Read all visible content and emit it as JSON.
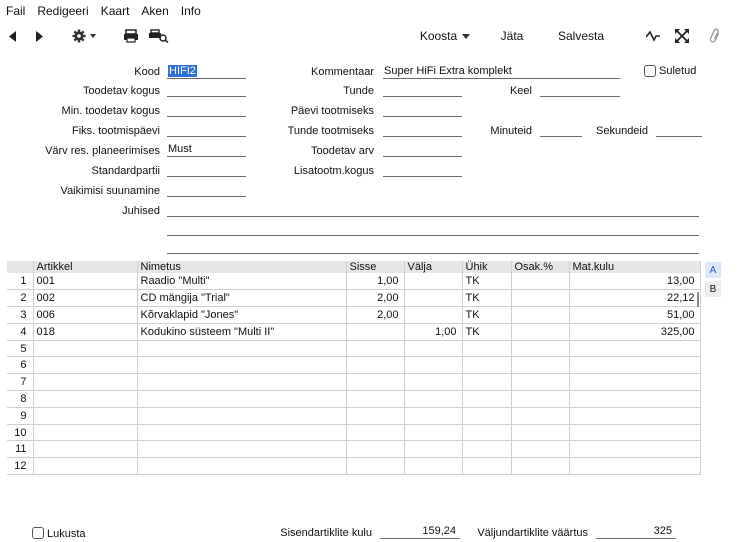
{
  "menu": [
    "Fail",
    "Redigeeri",
    "Kaart",
    "Aken",
    "Info"
  ],
  "toolbar": {
    "create": "Koosta",
    "skip": "Jäta",
    "save": "Salvesta"
  },
  "labels": {
    "code": "Kood",
    "qty_produced": "Toodetav kogus",
    "min_qty": "Min. toodetav kogus",
    "fixed_days": "Fiks. tootmispäevi",
    "colour_planning": "Värv res. planeerimises",
    "std_batch": "Standardpartii",
    "default_routing": "Vaikimisi suunamine",
    "instructions": "Juhised",
    "comment": "Kommentaar",
    "hours": "Tunde",
    "days_prod": "Päevi tootmiseks",
    "hours_prod": "Tunde tootmiseks",
    "value_produced": "Toodetav arv",
    "extra_qty": "Lisatootm.kogus",
    "language": "Keel",
    "minutes": "Minuteid",
    "seconds": "Sekundeid",
    "closed": "Suletud",
    "lock": "Lukusta",
    "input_cost": "Sisendartiklite kulu",
    "output_value": "Väljundartiklite väärtus"
  },
  "values": {
    "code": "HIFI2",
    "comment": "Super HiFi Extra komplekt",
    "colour_planning": "Must",
    "input_cost": "159,24",
    "output_value": "325"
  },
  "grid": {
    "columns": [
      "Artikkel",
      "Nimetus",
      "Sisse",
      "Välja",
      "Ühik",
      "Osak.%",
      "Mat.kulu"
    ],
    "rows": [
      [
        "1",
        "001",
        "Raadio \"Multi\"",
        "1,00",
        "",
        "TK",
        "",
        "13,00"
      ],
      [
        "2",
        "002",
        "CD mängija \"Trial\"",
        "2,00",
        "",
        "TK",
        "",
        "22,12"
      ],
      [
        "3",
        "006",
        "Kõrvaklapid \"Jones\"",
        "2,00",
        "",
        "TK",
        "",
        "51,00"
      ],
      [
        "4",
        "018",
        "Kodukino süsteem \"Multi II\"",
        "",
        "1,00",
        "TK",
        "",
        "325,00"
      ],
      [
        "5",
        "",
        "",
        "",
        "",
        "",
        "",
        ""
      ],
      [
        "6",
        "",
        "",
        "",
        "",
        "",
        "",
        ""
      ],
      [
        "7",
        "",
        "",
        "",
        "",
        "",
        "",
        ""
      ],
      [
        "8",
        "",
        "",
        "",
        "",
        "",
        "",
        ""
      ],
      [
        "9",
        "",
        "",
        "",
        "",
        "",
        "",
        ""
      ],
      [
        "10",
        "",
        "",
        "",
        "",
        "",
        "",
        ""
      ],
      [
        "11",
        "",
        "",
        "",
        "",
        "",
        "",
        ""
      ],
      [
        "12",
        "",
        "",
        "",
        "",
        "",
        "",
        ""
      ]
    ]
  },
  "tabs": [
    "A",
    "B"
  ],
  "icons": [
    "back-arrow-icon",
    "forward-arrow-icon",
    "gear-icon",
    "print-icon",
    "print-preview-icon",
    "pulse-icon",
    "expand-icon",
    "paperclip-icon"
  ]
}
